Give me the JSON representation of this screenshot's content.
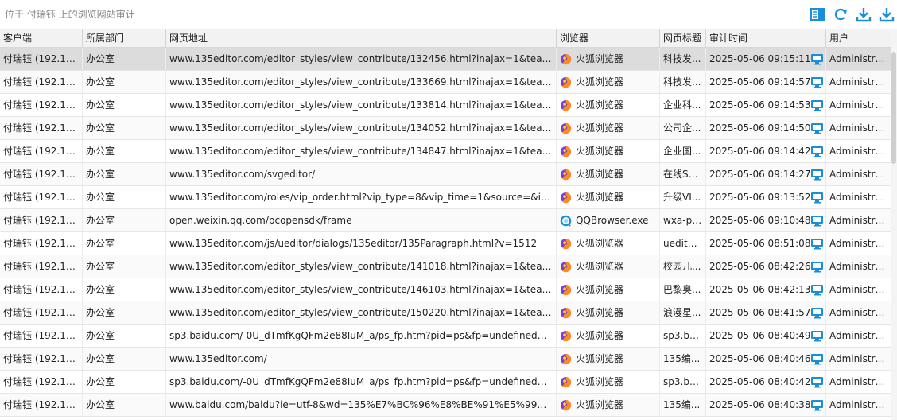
{
  "page": {
    "title": "位于 付瑞钰 上的浏览网站审计"
  },
  "toolbar": {
    "icons": [
      "panel-icon",
      "refresh-icon",
      "download-icon",
      "export-icon"
    ]
  },
  "columns": {
    "client": "客户端",
    "dept": "所属部门",
    "url": "网页地址",
    "browser": "浏览器",
    "page_title": "网页标题",
    "audit_time": "审计时间",
    "user": "用户"
  },
  "colors": {
    "accent": "#1a8fd8",
    "selected_row": "#dcdcdc"
  },
  "rows": [
    {
      "client": "付瑞钰 (192.16...",
      "dept": "办公室",
      "url": "www.135editor.com/editor_styles/view_contribute/132456.html?inajax=1&team_i...",
      "browser": "火狐浏览器",
      "browser_icon": "firefox",
      "page_title": "科技发...",
      "time": "2025-05-06 09:15:11",
      "user": "Administra..."
    },
    {
      "client": "付瑞钰 (192.16...",
      "dept": "办公室",
      "url": "www.135editor.com/editor_styles/view_contribute/133669.html?inajax=1&team_i...",
      "browser": "火狐浏览器",
      "browser_icon": "firefox",
      "page_title": "科技发...",
      "time": "2025-05-06 09:14:57",
      "user": "Administra..."
    },
    {
      "client": "付瑞钰 (192.16...",
      "dept": "办公室",
      "url": "www.135editor.com/editor_styles/view_contribute/133814.html?inajax=1&team_i...",
      "browser": "火狐浏览器",
      "browser_icon": "firefox",
      "page_title": "企业科...",
      "time": "2025-05-06 09:14:53",
      "user": "Administra..."
    },
    {
      "client": "付瑞钰 (192.16...",
      "dept": "办公室",
      "url": "www.135editor.com/editor_styles/view_contribute/134052.html?inajax=1&team_i...",
      "browser": "火狐浏览器",
      "browser_icon": "firefox",
      "page_title": "公司企...",
      "time": "2025-05-06 09:14:50",
      "user": "Administra..."
    },
    {
      "client": "付瑞钰 (192.16...",
      "dept": "办公室",
      "url": "www.135editor.com/editor_styles/view_contribute/134847.html?inajax=1&team_i...",
      "browser": "火狐浏览器",
      "browser_icon": "firefox",
      "page_title": "企业国...",
      "time": "2025-05-06 09:14:42",
      "user": "Administra..."
    },
    {
      "client": "付瑞钰 (192.16...",
      "dept": "办公室",
      "url": "www.135editor.com/svgeditor/",
      "browser": "火狐浏览器",
      "browser_icon": "firefox",
      "page_title": "在线SV...",
      "time": "2025-05-06 09:14:27",
      "user": "Administra..."
    },
    {
      "client": "付瑞钰 (192.16...",
      "dept": "办公室",
      "url": "www.135editor.com/roles/vip_order.html?vip_type=8&vip_time=1&source=&indi...",
      "browser": "火狐浏览器",
      "browser_icon": "firefox",
      "page_title": "升级VI...",
      "time": "2025-05-06 09:13:52",
      "user": "Administra..."
    },
    {
      "client": "付瑞钰 (192.16...",
      "dept": "办公室",
      "url": "open.weixin.qq.com/pcopensdk/frame",
      "browser": "QQBrowser.exe",
      "browser_icon": "qq",
      "page_title": "wxa-pc...",
      "time": "2025-05-06 09:10:48",
      "user": "Administra..."
    },
    {
      "client": "付瑞钰 (192.16...",
      "dept": "办公室",
      "url": "www.135editor.com/js/ueditor/dialogs/135editor/135Paragraph.html?v=1512",
      "browser": "火狐浏览器",
      "browser_icon": "firefox",
      "page_title": "uedito...",
      "time": "2025-05-06 08:51:08",
      "user": "Administra..."
    },
    {
      "client": "付瑞钰 (192.16...",
      "dept": "办公室",
      "url": "www.135editor.com/editor_styles/view_contribute/141018.html?inajax=1&team_i...",
      "browser": "火狐浏览器",
      "browser_icon": "firefox",
      "page_title": "校园儿...",
      "time": "2025-05-06 08:42:26",
      "user": "Administra..."
    },
    {
      "client": "付瑞钰 (192.16...",
      "dept": "办公室",
      "url": "www.135editor.com/editor_styles/view_contribute/146103.html?inajax=1&team_i...",
      "browser": "火狐浏览器",
      "browser_icon": "firefox",
      "page_title": "巴黎奥...",
      "time": "2025-05-06 08:42:13",
      "user": "Administra..."
    },
    {
      "client": "付瑞钰 (192.16...",
      "dept": "办公室",
      "url": "www.135editor.com/editor_styles/view_contribute/150220.html?inajax=1&team_i...",
      "browser": "火狐浏览器",
      "browser_icon": "firefox",
      "page_title": "浪漫星...",
      "time": "2025-05-06 08:41:57",
      "user": "Administra..."
    },
    {
      "client": "付瑞钰 (192.16...",
      "dept": "办公室",
      "url": "sp3.baidu.com/-0U_dTmfKgQFm2e88IuM_a/ps_fp.htm?pid=ps&fp=undefined&i...",
      "browser": "火狐浏览器",
      "browser_icon": "firefox",
      "page_title": "sp3.ba...",
      "time": "2025-05-06 08:40:49",
      "user": "Administra..."
    },
    {
      "client": "付瑞钰 (192.16...",
      "dept": "办公室",
      "url": "www.135editor.com/",
      "browser": "火狐浏览器",
      "browser_icon": "firefox",
      "page_title": "135编...",
      "time": "2025-05-06 08:40:46",
      "user": "Administra..."
    },
    {
      "client": "付瑞钰 (192.16...",
      "dept": "办公室",
      "url": "sp3.baidu.com/-0U_dTmfKgQFm2e88IuM_a/ps_fp.htm?pid=ps&fp=undefined&i...",
      "browser": "火狐浏览器",
      "browser_icon": "firefox",
      "page_title": "sp3.ba...",
      "time": "2025-05-06 08:40:42",
      "user": "Administra..."
    },
    {
      "client": "付瑞钰 (192.16...",
      "dept": "办公室",
      "url": "www.baidu.com/baidu?ie=utf-8&wd=135%E7%BC%96%E8%BE%91%E5%99%A8",
      "browser": "火狐浏览器",
      "browser_icon": "firefox",
      "page_title": "135编...",
      "time": "2025-05-06 08:40:38",
      "user": "Administra..."
    }
  ]
}
